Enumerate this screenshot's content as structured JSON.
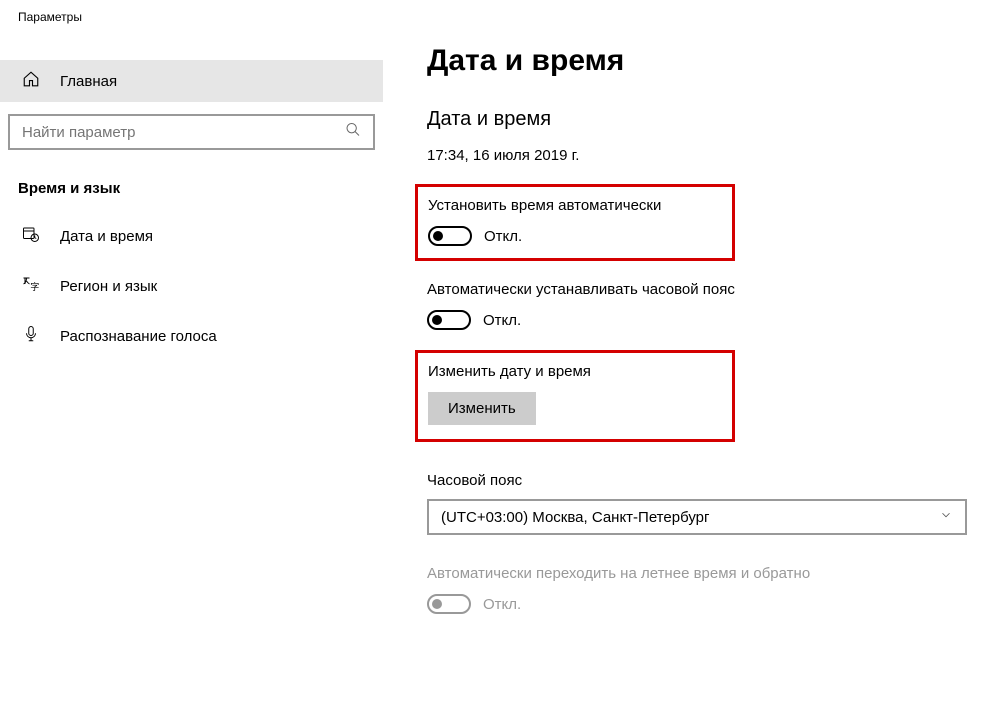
{
  "window_title": "Параметры",
  "sidebar": {
    "home_label": "Главная",
    "search_placeholder": "Найти параметр",
    "category_title": "Время и язык",
    "items": [
      {
        "label": "Дата и время"
      },
      {
        "label": "Регион и язык"
      },
      {
        "label": "Распознавание голоса"
      }
    ]
  },
  "content": {
    "page_title": "Дата и время",
    "section_title": "Дата и время",
    "current_datetime": "17:34, 16 июля 2019 г.",
    "auto_time": {
      "label": "Установить время автоматически",
      "state": "Откл."
    },
    "auto_tz": {
      "label": "Автоматически устанавливать часовой пояс",
      "state": "Откл."
    },
    "change_dt": {
      "label": "Изменить дату и время",
      "button": "Изменить"
    },
    "timezone": {
      "label": "Часовой пояс",
      "value": "(UTC+03:00) Москва, Санкт-Петербург"
    },
    "dst": {
      "label": "Автоматически переходить на летнее время и обратно",
      "state": "Откл."
    }
  }
}
